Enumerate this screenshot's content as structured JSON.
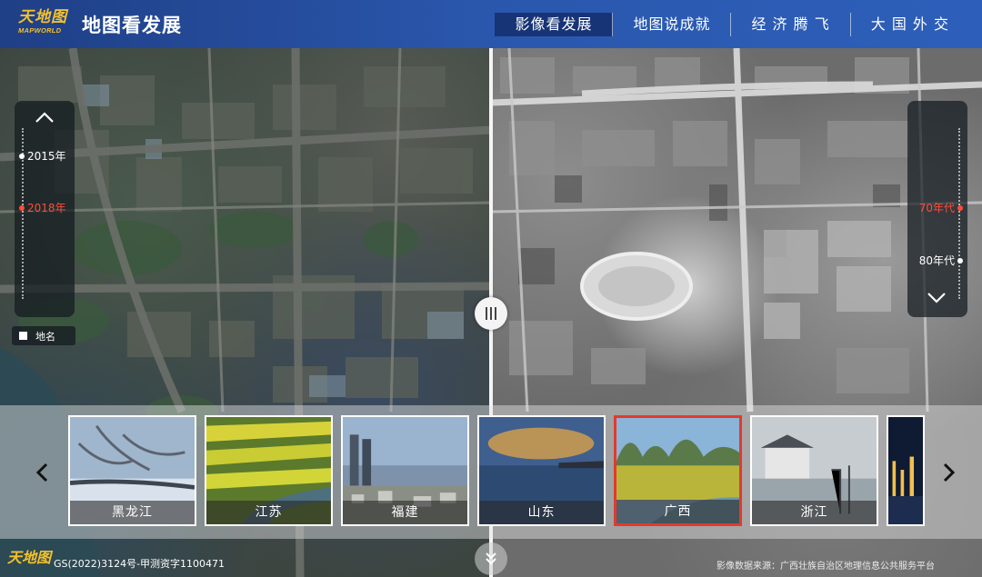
{
  "header": {
    "logo_cn": "天地图",
    "logo_en": "MAPWORLD",
    "title": "地图看发展",
    "nav": [
      {
        "label": "影像看发展",
        "active": true
      },
      {
        "label": "地图说成就",
        "active": false
      },
      {
        "label": "经 济 腾 飞",
        "active": false
      },
      {
        "label": "大 国 外 交",
        "active": false
      }
    ]
  },
  "left_timeline": {
    "up_icon": "chevron-up-icon",
    "items": [
      {
        "label": "2015年",
        "active": false
      },
      {
        "label": "2018年",
        "active": true
      }
    ]
  },
  "right_timeline": {
    "down_icon": "chevron-down-icon",
    "items": [
      {
        "label": "70年代",
        "active": true
      },
      {
        "label": "80年代",
        "active": false
      }
    ]
  },
  "place_toggle": {
    "label": "地名",
    "checked": false
  },
  "divider": {
    "icon": "drag-handle-icon"
  },
  "strip": {
    "prev_icon": "chevron-left-icon",
    "next_icon": "chevron-right-icon",
    "provinces": [
      {
        "label": "黑龙江",
        "selected": false
      },
      {
        "label": "江苏",
        "selected": false
      },
      {
        "label": "福建",
        "selected": false
      },
      {
        "label": "山东",
        "selected": false
      },
      {
        "label": "广西",
        "selected": true
      },
      {
        "label": "浙江",
        "selected": false
      },
      {
        "label": "",
        "selected": false
      }
    ]
  },
  "footer": {
    "logo": "天地图",
    "license": "GS(2022)3124号-甲测资字1100471",
    "source": "影像数据来源：广西壮族自治区地理信息公共服务平台",
    "scroll_icon": "double-chevron-down-icon"
  },
  "colors": {
    "header_start": "#1f3f86",
    "header_end": "#2d5fba",
    "active_year": "#ff4d3a",
    "selected_card": "#e23a2e",
    "logo_gold": "#f2c12e"
  }
}
